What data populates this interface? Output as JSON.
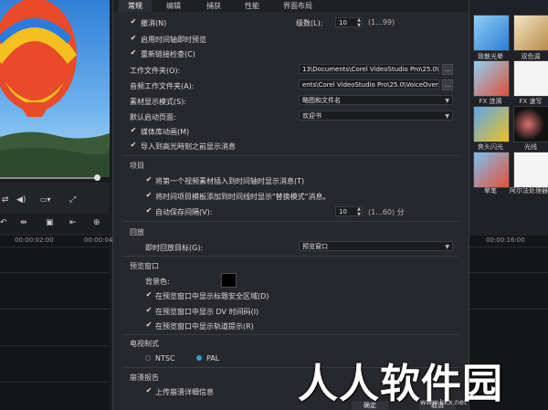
{
  "tabs": [
    "常规",
    "编辑",
    "捕获",
    "性能",
    "界面布局"
  ],
  "general": {
    "undo_label": "撤消(N)",
    "levels_label": "级数(L):",
    "levels_value": "10",
    "levels_range": "(1...99)",
    "instant_playback_label": "启用时间轴即时预览",
    "relink_check_label": "重新链接检查(C)",
    "work_folder_label": "工作文件夹(O):",
    "work_folder_value": "13\\Documents\\Corel VideoStudio Pro\\25.0\\",
    "audio_folder_label": "音频工作文件夹(A):",
    "audio_folder_value": "ents\\Corel VideoStudio Pro\\25.0\\VoiceOver\\",
    "browse_label": "...",
    "clip_display_label": "素材显示模式(S):",
    "clip_display_value": "略图和文件名",
    "startup_page_label": "默认启动页面:",
    "startup_page_value": "欢迎书",
    "media_animation_label": "媒体库动画(M)",
    "show_msg_before_import_label": "导入到高光時刻之前显示消息"
  },
  "project": {
    "section_title": "项目",
    "insert_msg_label": "将第一个视频素材插入到时间轴时显示消息(T)",
    "template_msg_label": "将时间项目模板添加到时间线时显示\"替换模式\"消息。",
    "autosave_label": "自动保存间隔(V):",
    "autosave_value": "10",
    "autosave_range": "(1...60) 分"
  },
  "playback": {
    "section_title": "回放",
    "target_label": "即时回放目标(G):",
    "target_value": "预览窗口"
  },
  "preview_window": {
    "section_title": "预览窗口",
    "bg_color_label": "背景色:",
    "bg_color": "#000000",
    "title_safe_label": "在预览窗口中显示标题安全区域(D)",
    "dv_timecode_label": "在预览窗口中显示 DV 时间码(I)",
    "track_hint_label": "在预览窗口中显示轨道提示(R)"
  },
  "tv_format": {
    "section_title": "电视制式",
    "ntsc_label": "NTSC",
    "pal_label": "PAL",
    "selected": "PAL"
  },
  "crash_report": {
    "section_title": "崩溃报告",
    "upload_label": "上传崩溃详细信息"
  },
  "footer": {
    "ok_label": "确定",
    "cancel_label": "取消"
  },
  "background": {
    "timecode_left": "00:00:02:00",
    "timecode_mid": "00:00:04",
    "timecode_right": "00:00:16:00",
    "library_labels": [
      "致散光晕",
      "双色调",
      "FX 涟漪",
      "FX 速写",
      "焦头闪光",
      "光线",
      "晕笔",
      "阿尔法处理器"
    ]
  },
  "watermark": {
    "text": "人人软件园",
    "url": "www.kkx.net"
  },
  "colors": {
    "accent": "#2fa2d8",
    "dialog_bg": "#27282d",
    "tab_active_bg": "#2e2f35"
  }
}
